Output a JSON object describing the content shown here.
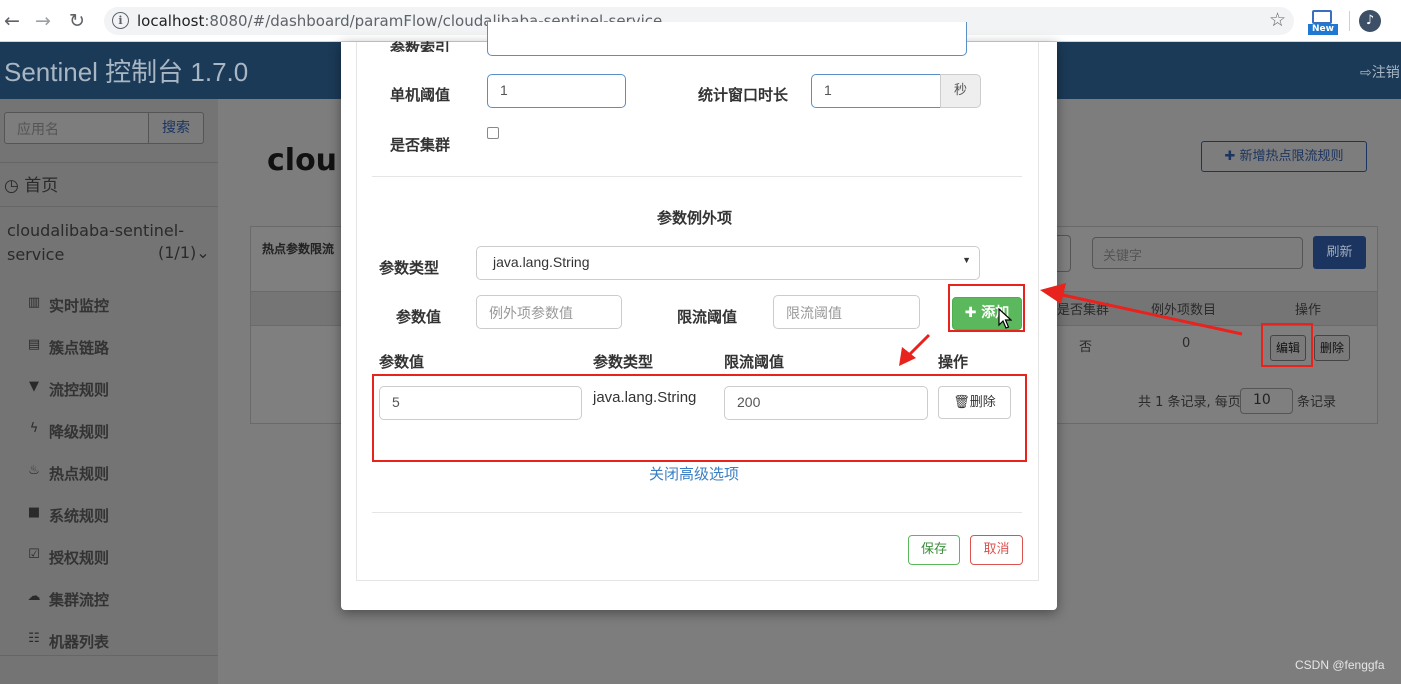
{
  "browser": {
    "url_host": "localhost",
    "url_path": ":8080/#/dashboard/paramFlow/cloudalibaba-sentinel-service",
    "ext_badge": "New"
  },
  "app": {
    "brand": "Sentinel 控制台 1.7.0",
    "logout": "注销"
  },
  "sidebar": {
    "search_placeholder": "应用名",
    "search_button": "搜索",
    "home": "首页",
    "app_name": "cloudalibaba-sentinel-service",
    "app_count": "(1/1)",
    "items": [
      {
        "label": "实时监控",
        "icon": "bar-chart-icon"
      },
      {
        "label": "簇点链路",
        "icon": "list-icon"
      },
      {
        "label": "流控规则",
        "icon": "filter-icon"
      },
      {
        "label": "降级规则",
        "icon": "flash-icon"
      },
      {
        "label": "热点规则",
        "icon": "fire-icon"
      },
      {
        "label": "系统规则",
        "icon": "lock-icon"
      },
      {
        "label": "授权规则",
        "icon": "check-square-icon"
      },
      {
        "label": "集群流控",
        "icon": "cloud-icon"
      },
      {
        "label": "机器列表",
        "icon": "th-list-icon"
      }
    ]
  },
  "main": {
    "title": "clou",
    "add_rule_button": "新增热点限流规则",
    "panel_label": "热点参数限流",
    "keyword_placeholder": "关键字",
    "refresh_button": "刷新",
    "columns": [
      "是否集群",
      "例外项数目",
      "操作"
    ],
    "row": {
      "cluster": "否",
      "exception_count": "0",
      "edit": "编辑",
      "delete": "删除"
    },
    "pager": {
      "summary": "共 1 条记录, 每页",
      "page_size": "10",
      "suffix": "条记录"
    }
  },
  "modal": {
    "top_label": "参数索引",
    "single_threshold_label": "单机阈值",
    "single_threshold_value": "1",
    "window_label": "统计窗口时长",
    "window_value": "1",
    "window_unit": "秒",
    "cluster_label": "是否集群",
    "section_title": "参数例外项",
    "param_type_label": "参数类型",
    "param_type_value": "java.lang.String",
    "param_value_label": "参数值",
    "param_value_placeholder": "例外项参数值",
    "limit_label": "限流阈值",
    "limit_placeholder": "限流阈值",
    "add_button": "添加",
    "table_headers": [
      "参数值",
      "参数类型",
      "限流阈值",
      "操作"
    ],
    "rows": [
      {
        "value": "5",
        "type": "java.lang.String",
        "limit": "200",
        "delete": "删除"
      }
    ],
    "advanced_link": "关闭高级选项",
    "save_button": "保存",
    "cancel_button": "取消"
  },
  "watermark": "CSDN @fenggfa",
  "colors": {
    "annotation_red": "#e8231e",
    "add_green": "#5cb85c",
    "link_blue": "#3a7fc4"
  }
}
